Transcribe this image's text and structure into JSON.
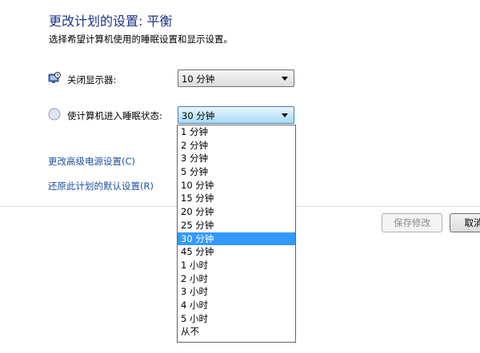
{
  "header": {
    "title": "更改计划的设置: 平衡",
    "subtitle": "选择希望计算机使用的睡眠设置和显示设置。"
  },
  "display_setting": {
    "label": "关闭显示器:",
    "value": "10 分钟",
    "icon": "monitor-off-icon"
  },
  "sleep_setting": {
    "label": "使计算机进入睡眠状态:",
    "value": "30 分钟",
    "icon": "sleep-moon-icon"
  },
  "links": {
    "advanced": "更改高级电源设置(C)",
    "restore": "还原此计划的默认设置(R)"
  },
  "buttons": {
    "save": "保存修改",
    "cancel": "取消"
  },
  "sleep_options": [
    "1 分钟",
    "2 分钟",
    "3 分钟",
    "5 分钟",
    "10 分钟",
    "15 分钟",
    "20 分钟",
    "25 分钟",
    "30 分钟",
    "45 分钟",
    "1 小时",
    "2 小时",
    "3 小时",
    "4 小时",
    "5 小时",
    "从不"
  ],
  "selected_option": "30 分钟",
  "colors": {
    "title": "#1e3287",
    "link": "#1e50a2",
    "selection": "#3399ff"
  }
}
